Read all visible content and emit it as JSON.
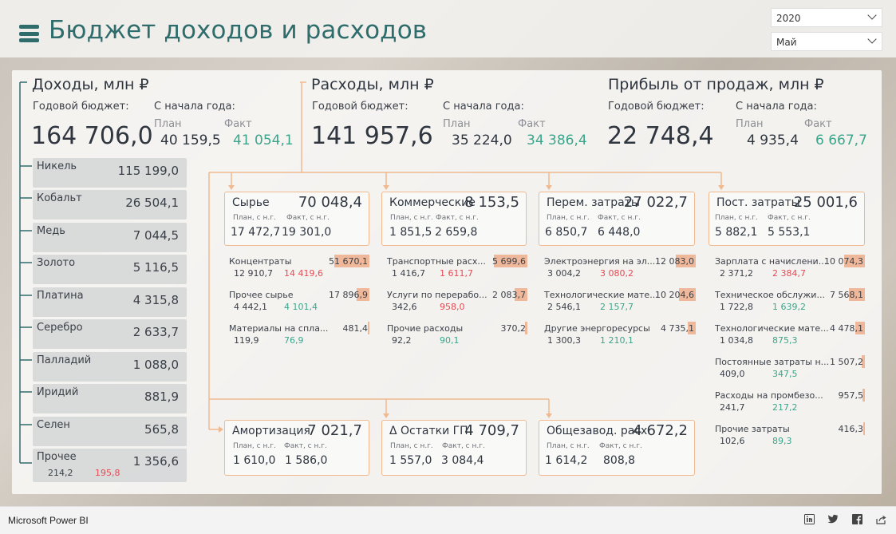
{
  "header": {
    "title": "Бюджет доходов и расходов"
  },
  "filters": {
    "year": "2020",
    "month": "Май"
  },
  "income": {
    "title": "Доходы, млн ₽",
    "annual_label": "Годовой бюджет:",
    "ytd_label": "С начала года:",
    "plan_label": "План",
    "fact_label": "Факт",
    "annual": "164 706,0",
    "plan": "40 159,5",
    "fact": "41 054,1"
  },
  "expenses": {
    "title": "Расходы, млн ₽",
    "annual_label": "Годовой бюджет:",
    "ytd_label": "С начала года:",
    "plan_label": "План",
    "fact_label": "Факт",
    "annual": "141 957,6",
    "plan": "35 224,0",
    "fact": "34 386,4"
  },
  "profit": {
    "title": "Прибыль от продаж, млн ₽",
    "annual_label": "Годовой бюджет:",
    "ytd_label": "С начала года:",
    "plan_label": "План",
    "fact_label": "Факт",
    "annual": "22 748,4",
    "plan": "4 935,4",
    "fact": "6 667,7"
  },
  "metals": [
    {
      "name": "Никель",
      "value": "115 199,0"
    },
    {
      "name": "Кобальт",
      "value": "26 504,1"
    },
    {
      "name": "Медь",
      "value": "7 044,5"
    },
    {
      "name": "Золото",
      "value": "5 116,5"
    },
    {
      "name": "Платина",
      "value": "4 315,8"
    },
    {
      "name": "Серебро",
      "value": "2 633,7"
    },
    {
      "name": "Палладий",
      "value": "1 088,0"
    },
    {
      "name": "Иридий",
      "value": "881,9"
    },
    {
      "name": "Селен",
      "value": "565,8"
    },
    {
      "name": "Прочее",
      "value": "1 356,6",
      "plan": "214,2",
      "fact": "195,8"
    }
  ],
  "labels": {
    "plan_ytd": "План, с н.г.",
    "fact_ytd": "Факт, с н.г."
  },
  "cost_boxes": {
    "raw": {
      "name": "Сырье",
      "value": "70 048,4",
      "plan": "17 472,7",
      "fact": "19 301,0"
    },
    "commercial": {
      "name": "Коммерческие",
      "value": "8 153,5",
      "plan": "1 851,5",
      "fact": "2 659,8"
    },
    "variable": {
      "name": "Перем. затраты",
      "value": "27 022,7",
      "plan": "6 850,7",
      "fact": "6 448,0"
    },
    "fixed": {
      "name": "Пост. затраты",
      "value": "25 001,6",
      "plan": "5 882,1",
      "fact": "5 553,1"
    },
    "amort": {
      "name": "Амортизация",
      "value": "7 021,7",
      "plan": "1 610,0",
      "fact": "1 586,0"
    },
    "stock": {
      "name": "Δ Остатки ГП",
      "value": "4 709,7",
      "plan": "1 557,0",
      "fact": "3 084,4"
    },
    "overhead": {
      "name": "Общезавод. расх.",
      "value": "4 672,2",
      "plan": "1 614,2",
      "fact": "808,8"
    }
  },
  "raw_items": [
    {
      "name": "Концентраты",
      "value": "51 670,1",
      "plan": "12 910,7",
      "fact": "14 419,6",
      "fact_color": "red",
      "bar": 0.74
    },
    {
      "name": "Прочее сырье",
      "value": "17 896,9",
      "plan": "4 442,1",
      "fact": "4 101,4",
      "fact_color": "green",
      "bar": 0.26
    },
    {
      "name": "Материалы на спла...",
      "value": "481,4",
      "plan": "119,9",
      "fact": "76,9",
      "fact_color": "green",
      "bar": 0.01
    }
  ],
  "commercial_items": [
    {
      "name": "Транспортные расх...",
      "value": "5 699,6",
      "plan": "1 416,7",
      "fact": "1 611,7",
      "fact_color": "red",
      "bar": 0.7
    },
    {
      "name": "Услуги по перерабо...",
      "value": "2 083,7",
      "plan": "342,6",
      "fact": "958,0",
      "fact_color": "red",
      "bar": 0.26
    },
    {
      "name": "Прочие расходы",
      "value": "370,2",
      "plan": "92,2",
      "fact": "90,1",
      "fact_color": "green",
      "bar": 0.05
    }
  ],
  "variable_items": [
    {
      "name": "Электроэнергия на эл...",
      "value": "12 083,0",
      "plan": "3 004,2",
      "fact": "3 080,2",
      "fact_color": "red",
      "bar": 0.45
    },
    {
      "name": "Технологические мате...",
      "value": "10 204,6",
      "plan": "2 546,1",
      "fact": "2 157,7",
      "fact_color": "green",
      "bar": 0.38
    },
    {
      "name": "Другие энергоресурсы",
      "value": "4 735,1",
      "plan": "1 300,3",
      "fact": "1 210,1",
      "fact_color": "green",
      "bar": 0.18
    }
  ],
  "fixed_items": [
    {
      "name": "Зарплата с начислени...",
      "value": "10 074,3",
      "plan": "2 371,2",
      "fact": "2 384,7",
      "fact_color": "red",
      "bar": 0.4
    },
    {
      "name": "Техническое обслужи...",
      "value": "7 568,1",
      "plan": "1 722,8",
      "fact": "1 639,2",
      "fact_color": "green",
      "bar": 0.3
    },
    {
      "name": "Технологические мате...",
      "value": "4 478,1",
      "plan": "1 034,8",
      "fact": "875,3",
      "fact_color": "green",
      "bar": 0.18
    },
    {
      "name": "Постоянные затраты н...",
      "value": "1 507,2",
      "plan": "409,0",
      "fact": "347,5",
      "fact_color": "green",
      "bar": 0.06
    },
    {
      "name": "Расходы на промбезо...",
      "value": "957,5",
      "plan": "241,7",
      "fact": "217,2",
      "fact_color": "green",
      "bar": 0.04
    },
    {
      "name": "Прочие затраты",
      "value": "416,3",
      "plan": "102,6",
      "fact": "89,3",
      "fact_color": "green",
      "bar": 0.02
    }
  ],
  "footer": {
    "brand": "Microsoft Power BI"
  },
  "colors": {
    "accent": "#2f6d6d",
    "green": "#3aa68b",
    "red": "#e84a55",
    "box_border": "#f0b98f",
    "bar": "#efb89a"
  }
}
